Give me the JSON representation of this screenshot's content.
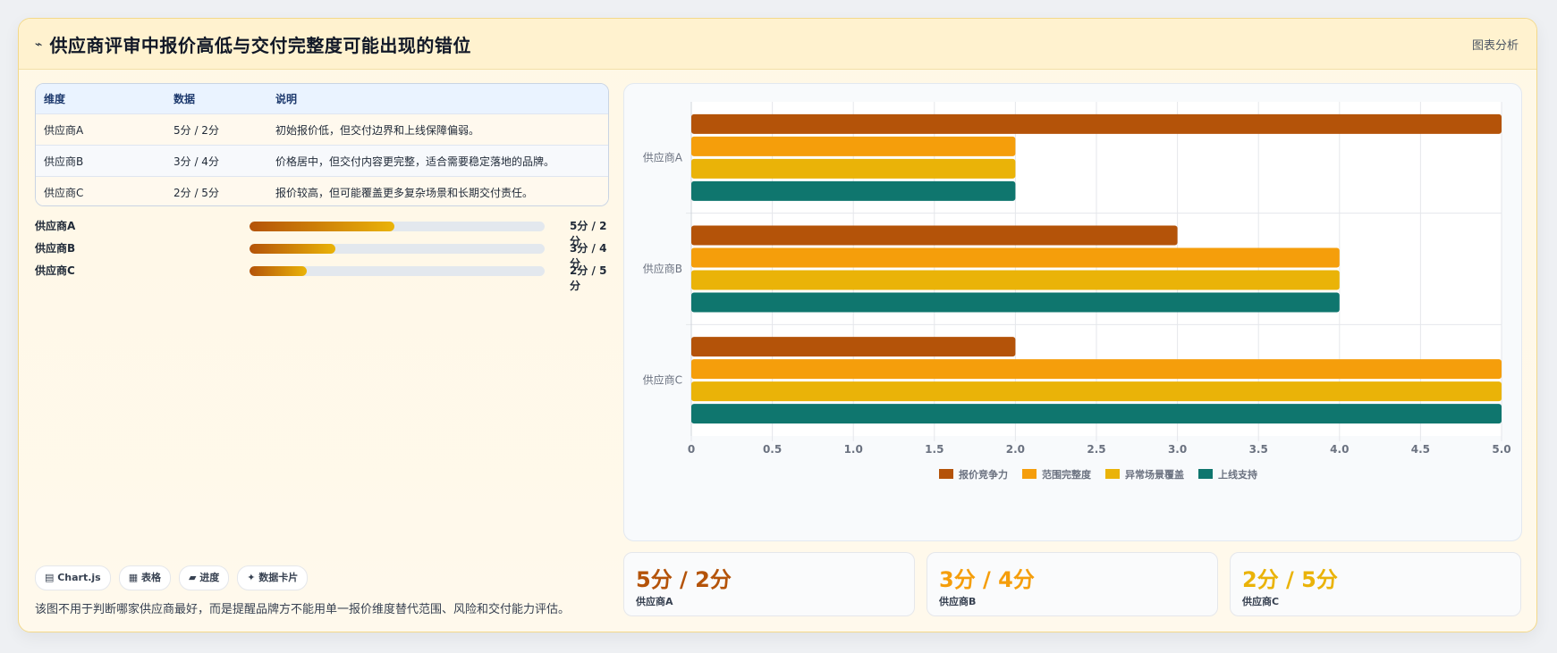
{
  "header": {
    "icon": "⌁",
    "title": "供应商评审中报价高低与交付完整度可能出现的错位",
    "right_label": "图表分析"
  },
  "table": {
    "headers": [
      "维度",
      "数据",
      "说明"
    ],
    "rows": [
      [
        "供应商A",
        "5分 / 2分",
        "初始报价低，但交付边界和上线保障偏弱。"
      ],
      [
        "供应商B",
        "3分 / 4分",
        "价格居中，但交付内容更完整，适合需要稳定落地的品牌。"
      ],
      [
        "供应商C",
        "2分 / 5分",
        "报价较高，但可能覆盖更多复杂场景和长期交付责任。"
      ]
    ]
  },
  "progress": [
    {
      "label": "供应商A",
      "value": "5分 / 2分",
      "fraction": 0.49
    },
    {
      "label": "供应商B",
      "value": "3分 / 4分",
      "fraction": 0.29
    },
    {
      "label": "供应商C",
      "value": "2分 / 5分",
      "fraction": 0.195
    }
  ],
  "pills": [
    "▤ Chart.js",
    "▦ 表格",
    "▰ 进度",
    "✦ 数据卡片"
  ],
  "note": "该图不用于判断哪家供应商最好，而是提醒品牌方不能用单一报价维度替代范围、风险和交付能力评估。",
  "stats": [
    {
      "value": "5分 / 2分",
      "label": "供应商A",
      "color": "#b45309"
    },
    {
      "value": "3分 / 4分",
      "label": "供应商B",
      "color": "#f59e0b"
    },
    {
      "value": "2分 / 5分",
      "label": "供应商C",
      "color": "#eab308"
    }
  ],
  "chart_data": {
    "type": "bar",
    "orientation": "horizontal",
    "categories": [
      "供应商A",
      "供应商B",
      "供应商C"
    ],
    "series": [
      {
        "name": "报价竞争力",
        "values": [
          5,
          3,
          2
        ],
        "color": "#b45309"
      },
      {
        "name": "范围完整度",
        "values": [
          2,
          4,
          5
        ],
        "color": "#f59e0b"
      },
      {
        "name": "异常场景覆盖",
        "values": [
          2,
          4,
          5
        ],
        "color": "#eab308"
      },
      {
        "name": "上线支持",
        "values": [
          2,
          4,
          5
        ],
        "color": "#0f766e"
      }
    ],
    "xlim": [
      0,
      5
    ],
    "x_ticks": [
      "0",
      "0.5",
      "1.0",
      "1.5",
      "2.0",
      "2.5",
      "3.0",
      "3.5",
      "4.0",
      "4.5",
      "5.0"
    ],
    "grid": true,
    "legend": "bottom"
  }
}
